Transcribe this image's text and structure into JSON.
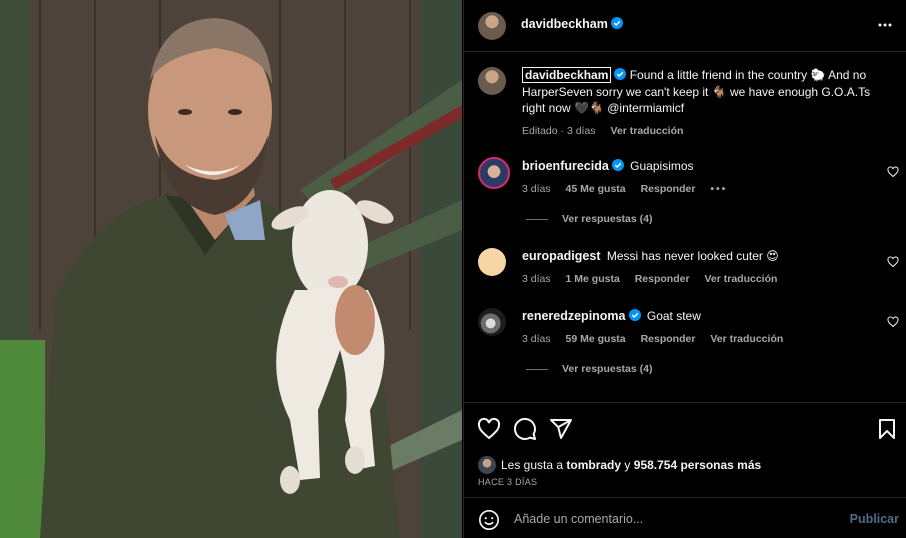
{
  "post": {
    "author": "davidbeckham",
    "more_icon": "more-horizontal-icon",
    "caption": {
      "username": "davidbeckham",
      "text": "Found a little friend in the country 🐑 And no HarperSeven sorry we can't keep it 🐐 we have enough G.O.A.Ts right now 🖤🐐 @intermiamicf",
      "time": "Editado · 3 días",
      "translate": "Ver traducción"
    }
  },
  "comments": [
    {
      "user": "brioenfurecida",
      "verified": true,
      "text": "Guapisimos",
      "time": "3 días",
      "likes": "45 Me gusta",
      "reply": "Responder",
      "replies": "Ver respuestas (4)"
    },
    {
      "user": "europadigest",
      "verified": false,
      "text": "Messi has never looked cuter 😍",
      "time": "3 días",
      "likes": "1 Me gusta",
      "reply": "Responder",
      "translate": "Ver traducción"
    },
    {
      "user": "reneredzepinoma",
      "verified": true,
      "text": "Goat stew",
      "time": "3 días",
      "likes": "59 Me gusta",
      "reply": "Responder",
      "translate": "Ver traducción",
      "replies": "Ver respuestas (4)"
    }
  ],
  "actions": {
    "icons": [
      "heart-icon",
      "comment-icon",
      "share-icon",
      "bookmark-icon"
    ],
    "likes_prefix": "Les gusta a",
    "likes_user": "tombrady",
    "likes_conj": "y",
    "likes_count": "958.754 personas más",
    "ago": "HACE 3 DÍAS"
  },
  "add_comment": {
    "placeholder": "Añade un comentario...",
    "publish": "Publicar"
  },
  "colors": {
    "verified": "#0095f6",
    "publish": "#4f6d8a",
    "border": "#262626",
    "secondary": "#a8a8a8"
  }
}
